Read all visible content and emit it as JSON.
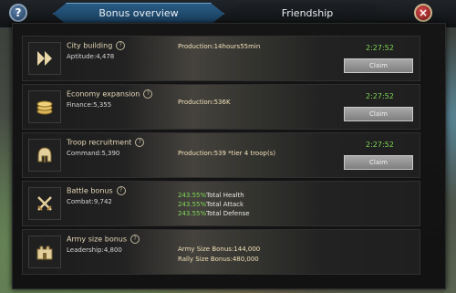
{
  "header": {
    "help_symbol": "?",
    "close_symbol": "×",
    "tabs": [
      {
        "label": "Bonus overview",
        "active": true
      },
      {
        "label": "Friendship",
        "active": false
      }
    ]
  },
  "rows": [
    {
      "icon": "double-chevron-right-icon",
      "title": "City building",
      "attr": "Aptitude:4,478",
      "production": "Production:14hours55min",
      "timer": "2:27:52",
      "claim_label": "Claim"
    },
    {
      "icon": "coin-stack-icon",
      "title": "Economy expansion",
      "attr": "Finance:5,355",
      "production": "Production:536K",
      "timer": "2:27:52",
      "claim_label": "Claim"
    },
    {
      "icon": "helmet-icon",
      "title": "Troop recruitment",
      "attr": "Command:5,390",
      "production": "Production:539 *tier 4 troop(s)",
      "timer": "2:27:52",
      "claim_label": "Claim"
    },
    {
      "icon": "crossed-swords-icon",
      "title": "Battle bonus",
      "attr": "Combat:9,742",
      "bonuses": [
        {
          "percent": "243.55%",
          "label": "Total Health"
        },
        {
          "percent": "243.55%",
          "label": "Total Attack"
        },
        {
          "percent": "243.55%",
          "label": "Total Defense"
        }
      ]
    },
    {
      "icon": "fortress-icon",
      "title": "Army size bonus",
      "attr": "Leadership:4,800",
      "army_size": "Army Size Bonus:144,000",
      "rally_size": "Rally Size Bonus:480,000"
    }
  ],
  "colors": {
    "accent_green": "#7ed957",
    "title_gold": "#e6d7b8",
    "tab_active": "#2a5d86",
    "close_red": "#c23a3a"
  }
}
